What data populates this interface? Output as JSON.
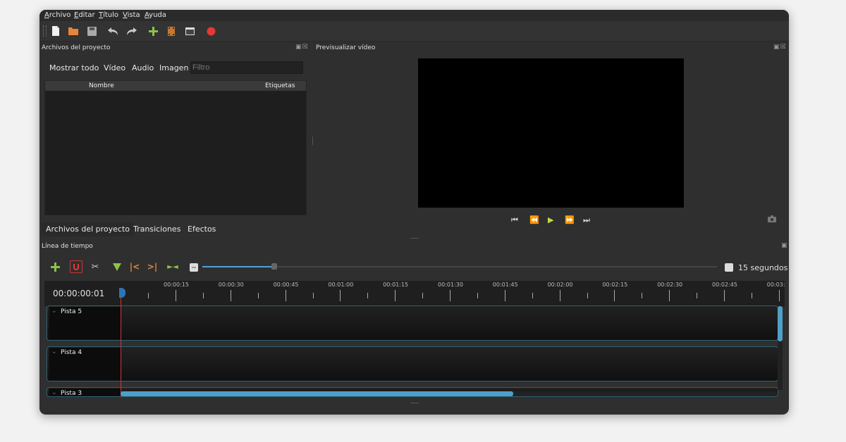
{
  "menu": [
    "Archivo",
    "Editar",
    "Título",
    "Vista",
    "Ayuda"
  ],
  "toolbar": {
    "icons": [
      "new-file",
      "open-file",
      "save-file",
      "undo",
      "redo",
      "import-files",
      "profile",
      "full-screen",
      "export-video"
    ]
  },
  "project_panel": {
    "title": "Archivos del proyecto",
    "filters": [
      "Mostrar todo",
      "Vídeo",
      "Audio",
      "Imagen"
    ],
    "filter_placeholder": "Filtro",
    "columns": [
      "Nombre",
      "Etiquetas"
    ],
    "bottom_tabs": [
      "Archivos del proyecto",
      "Transiciones",
      "Efectos"
    ]
  },
  "preview_panel": {
    "title": "Previsualizar vídeo"
  },
  "timeline": {
    "title": "Línea de tiempo",
    "zoom_label": "15 segundos",
    "current_time": "00:00:00:01",
    "ruler_labels": [
      "00:00:15",
      "00:00:30",
      "00:00:45",
      "00:01:00",
      "00:01:15",
      "00:01:30",
      "00:01:45",
      "00:02:00",
      "00:02:15",
      "00:02:30",
      "00:02:45",
      "00:03:"
    ],
    "tracks": [
      "Pista 5",
      "Pista 4",
      "Pista 3"
    ]
  },
  "colors": {
    "accent": "#4fa0c8",
    "playhead": "#c43b3b",
    "add": "#8bc34a",
    "record": "#e53935"
  }
}
